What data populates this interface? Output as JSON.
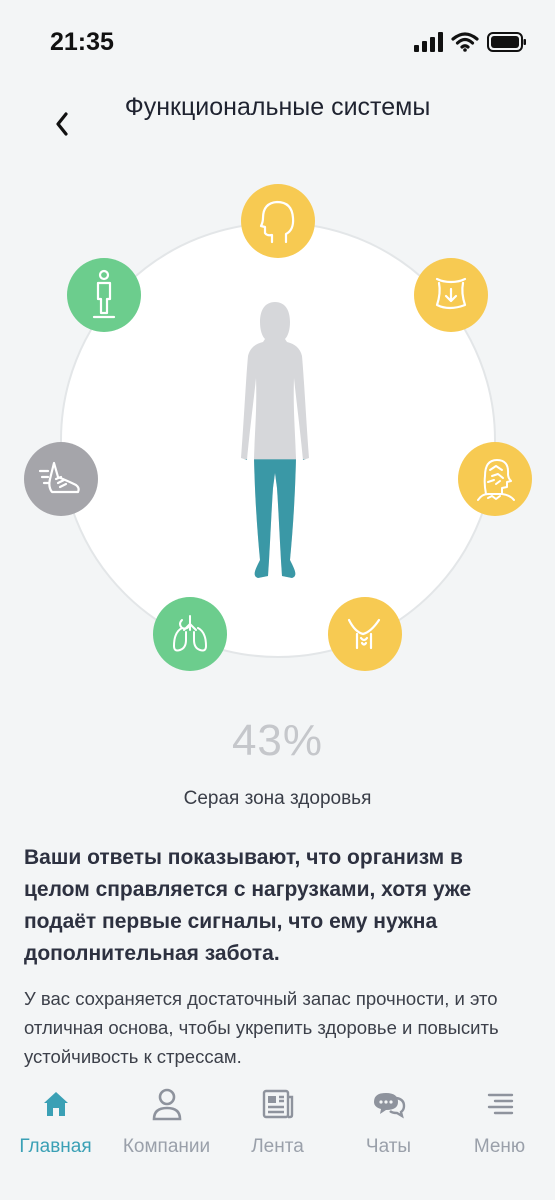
{
  "status_bar": {
    "time": "21:35"
  },
  "header": {
    "title": "Функциональные системы"
  },
  "systems": [
    {
      "name": "head",
      "color": "yellow"
    },
    {
      "name": "abdomen",
      "color": "yellow"
    },
    {
      "name": "nervous-system",
      "color": "yellow"
    },
    {
      "name": "throat",
      "color": "yellow"
    },
    {
      "name": "heart-lungs",
      "color": "green"
    },
    {
      "name": "running-shoe",
      "color": "gray"
    },
    {
      "name": "person-body",
      "color": "green"
    }
  ],
  "colors": {
    "yellow": "#f7ca52",
    "green": "#6ccd8d",
    "gray": "#a5a5aa",
    "teal": "#3a98a6",
    "accent": "#3aa0b5"
  },
  "score": {
    "value": "43%",
    "label": "Серая зона здоровья",
    "fill_fraction": 0.43
  },
  "summary": "Ваши ответы показывают, что организм в целом справляется с нагрузками, хотя уже подаёт первые сигналы, что ему нужна дополнительная забота.",
  "details": "У вас сохраняется достаточный запас прочности, и это отличная основа, чтобы укрепить здоровье и повысить устойчивость к стрессам.",
  "nav": {
    "items": [
      {
        "label": "Главная",
        "icon": "home-icon",
        "active": true
      },
      {
        "label": "Компании",
        "icon": "person-icon",
        "active": false
      },
      {
        "label": "Лента",
        "icon": "newspaper-icon",
        "active": false
      },
      {
        "label": "Чаты",
        "icon": "chat-icon",
        "active": false
      },
      {
        "label": "Меню",
        "icon": "menu-icon",
        "active": false
      }
    ]
  }
}
